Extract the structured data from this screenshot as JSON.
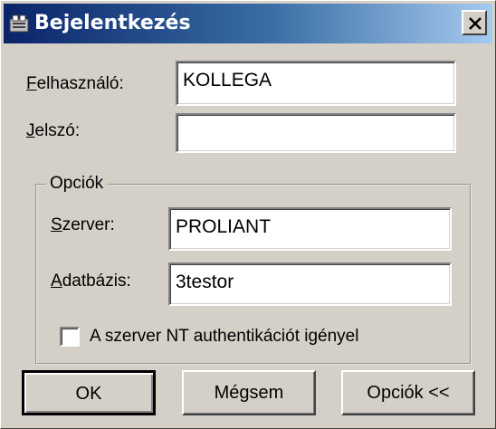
{
  "window": {
    "title": "Bejelentkezés",
    "icon": "login-app-icon",
    "close_icon": "close-icon",
    "accent": "#0a246a"
  },
  "form": {
    "username": {
      "label_first": "F",
      "label_rest": "elhasználó:",
      "value": "KOLLEGA"
    },
    "password": {
      "label_first": "J",
      "label_rest": "elszó:",
      "value": ""
    }
  },
  "options": {
    "legend": "Opciók",
    "server": {
      "label_first": "S",
      "label_rest": "zerver:",
      "value": "PROLIANT"
    },
    "database": {
      "label_first": "A",
      "label_rest": "datbázis:",
      "value": "3testor"
    },
    "nt_auth": {
      "label": "A szerver NT authentikációt igényel",
      "checked": false
    }
  },
  "buttons": {
    "ok": "OK",
    "cancel": "Mégsem",
    "options": "Opciók <<"
  }
}
